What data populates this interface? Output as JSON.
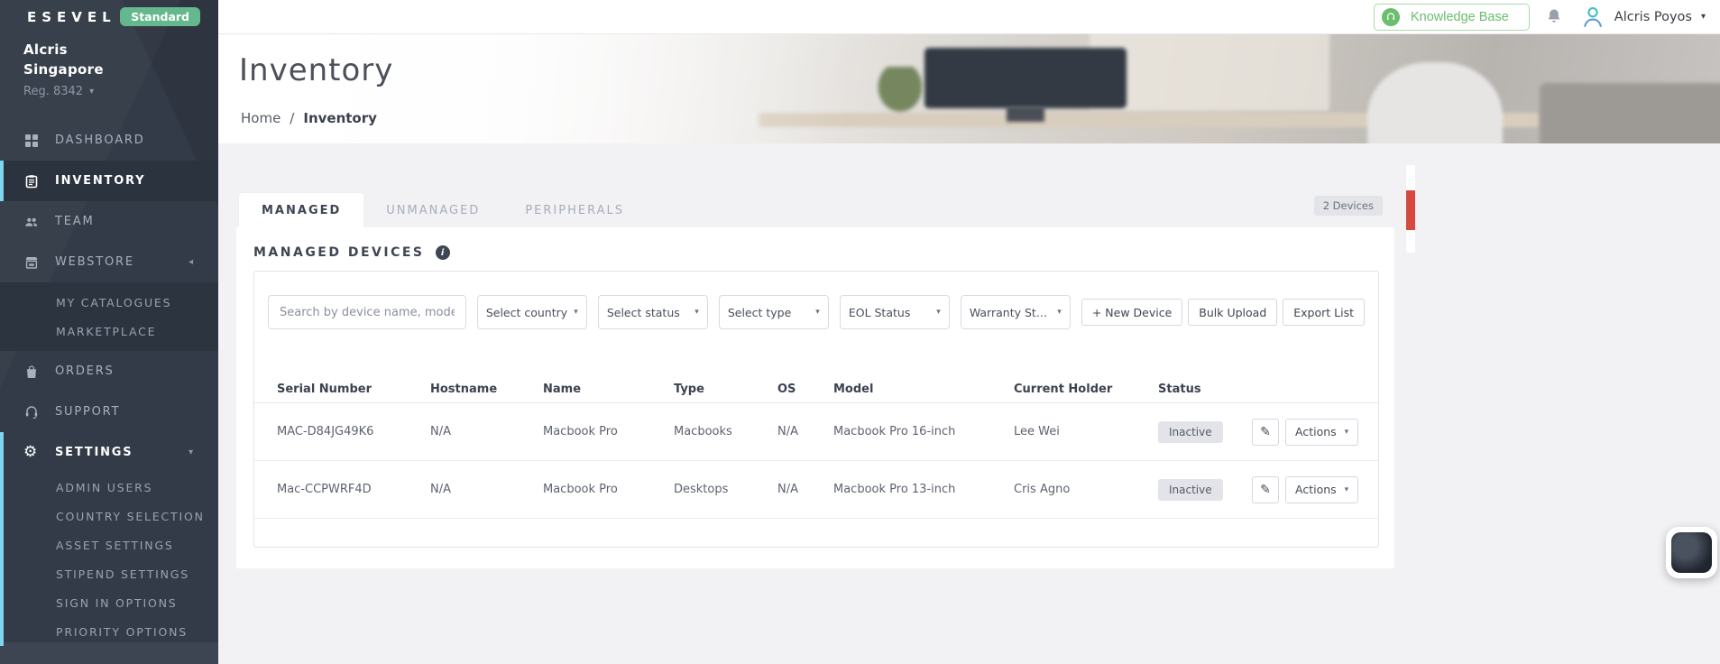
{
  "brand": {
    "logo": "ESEVEL",
    "plan_badge": "Standard",
    "company_name": "Alcris Singapore",
    "registration": "Reg. 8342"
  },
  "topbar": {
    "knowledge_base_label": "Knowledge Base",
    "user_name": "Alcris Poyos"
  },
  "sidebar": {
    "items": [
      {
        "label": "DASHBOARD"
      },
      {
        "label": "INVENTORY"
      },
      {
        "label": "TEAM"
      },
      {
        "label": "WEBSTORE",
        "children": [
          "MY CATALOGUES",
          "MARKETPLACE"
        ]
      },
      {
        "label": "ORDERS"
      },
      {
        "label": "SUPPORT"
      },
      {
        "label": "SETTINGS",
        "children": [
          "ADMIN USERS",
          "COUNTRY SELECTION",
          "ASSET SETTINGS",
          "STIPEND SETTINGS",
          "SIGN IN OPTIONS",
          "PRIORITY OPTIONS"
        ]
      }
    ]
  },
  "page": {
    "title": "Inventory",
    "breadcrumb_home": "Home",
    "breadcrumb_separator": "/",
    "breadcrumb_current": "Inventory"
  },
  "tabs": [
    {
      "label": "MANAGED"
    },
    {
      "label": "UNMANAGED"
    },
    {
      "label": "PERIPHERALS"
    }
  ],
  "managed": {
    "section_title": "MANAGED DEVICES",
    "device_count_badge": "2 Devices",
    "search_placeholder": "Search by device name, model, OS, ID or owner",
    "filters": [
      "Select country",
      "Select status",
      "Select type",
      "EOL Status",
      "Warranty Status"
    ],
    "buttons": {
      "new_device": "+ New Device",
      "bulk_upload": "Bulk Upload",
      "export_list": "Export List"
    },
    "table": {
      "columns": [
        "Serial Number",
        "Hostname",
        "Name",
        "Type",
        "OS",
        "Model",
        "Current Holder",
        "Status"
      ],
      "row_action_label": "Actions",
      "rows": [
        {
          "serial": "MAC-D84JG49K6",
          "hostname": "N/A",
          "name": "Macbook Pro",
          "type": "Macbooks",
          "os": "N/A",
          "model": "Macbook Pro 16-inch",
          "holder": "Lee Wei",
          "status": "Inactive"
        },
        {
          "serial": "Mac-CCPWRF4D",
          "hostname": "N/A",
          "name": "Macbook Pro",
          "type": "Desktops",
          "os": "N/A",
          "model": "Macbook Pro 13-inch",
          "holder": "Cris Agno",
          "status": "Inactive"
        }
      ]
    }
  },
  "icons": {
    "pencil": "✎",
    "caret_down": "▾",
    "chevron_left": "◂",
    "info": "i",
    "gear": "⚙"
  },
  "colors": {
    "sidebar_bg": "#333B48",
    "active_accent": "#7FD4EE",
    "badge_green": "#65B88D",
    "button_green": "#6ABE6E",
    "status_pill_bg": "#E3E4E9",
    "page_bg": "#F2F2F4",
    "scroll_marker_red": "#D5493F"
  }
}
